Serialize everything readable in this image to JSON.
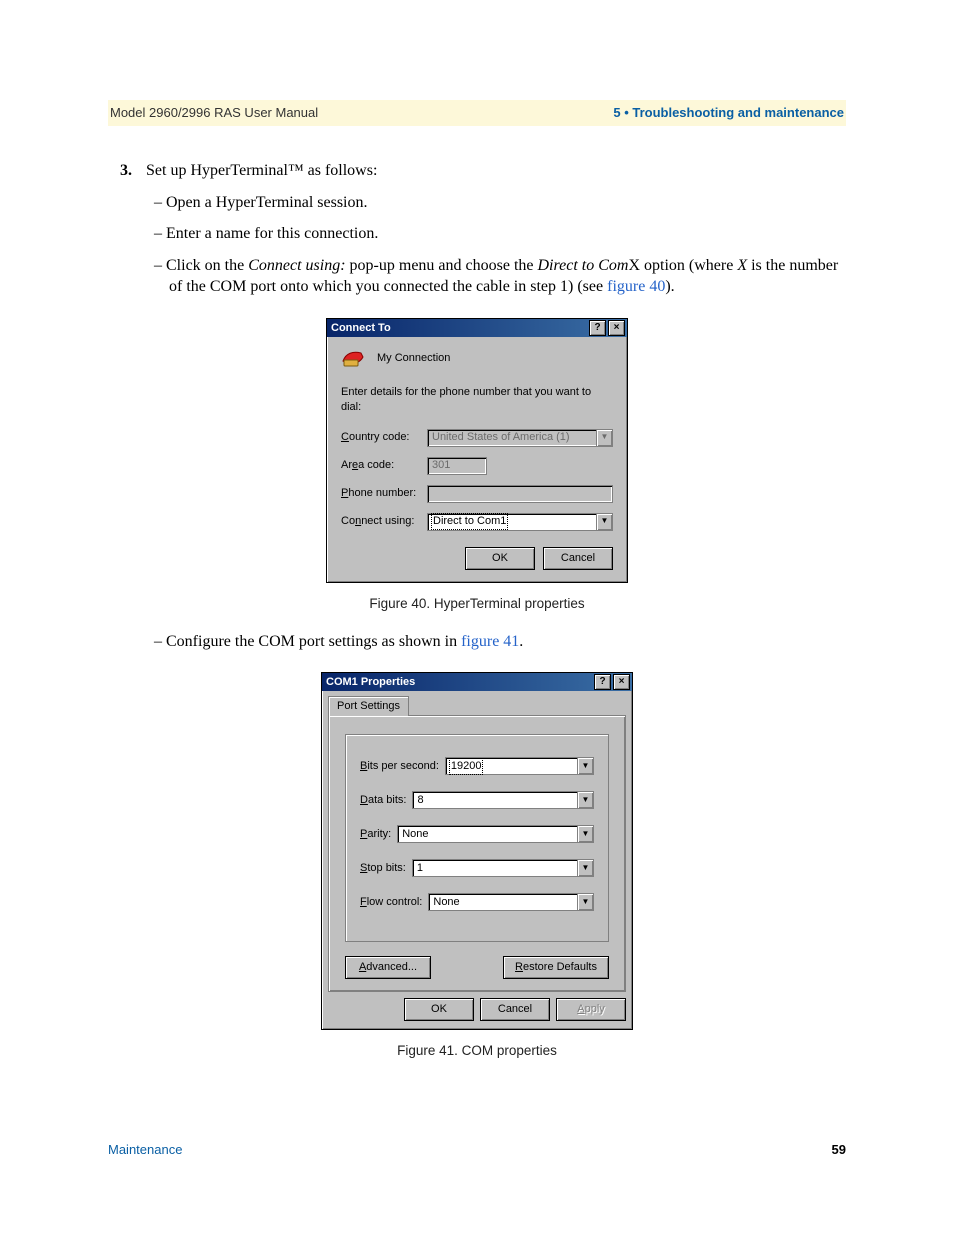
{
  "header": {
    "left": "Model 2960/2996 RAS User Manual",
    "right": "5 • Troubleshooting and maintenance"
  },
  "step": {
    "num": "3.",
    "text": "Set up HyperTerminal™ as follows:"
  },
  "bul": {
    "a": "Open a HyperTerminal session.",
    "b": "Enter a name for this connection.",
    "c_pre": "Click on the ",
    "c_i1": "Connect using:",
    "c_mid": " pop-up menu and choose the ",
    "c_i2": "Direct to Com",
    "c_x": "X option (where ",
    "c_i3": "X",
    "c_post": " is the number of the COM port onto which you connected the cable in step 1) (see ",
    "c_link": "figure 40",
    "c_end": ").",
    "d_pre": "Configure the COM port settings as shown in ",
    "d_link": "figure 41",
    "d_end": "."
  },
  "fig40": {
    "title": "Connect To",
    "help": "?",
    "close": "×",
    "conn": "My Connection",
    "prompt": "Enter details for the phone number that you want to dial:",
    "country_l": "ountry code:",
    "country_u": "C",
    "country_v": "United States of America (1)",
    "area_l": "Ar",
    "area_u": "e",
    "area_l2": "a code:",
    "area_v": "301",
    "phone_l": "hone number:",
    "phone_u": "P",
    "phone_v": "",
    "connect_l": "Co",
    "connect_u": "n",
    "connect_l2": "nect using:",
    "connect_v": "Direct to Com1",
    "ok": "OK",
    "cancel": "Cancel",
    "cap": "Figure 40. HyperTerminal properties"
  },
  "fig41": {
    "title": "COM1 Properties",
    "help": "?",
    "close": "×",
    "tab": "Port Settings",
    "bits_l": "its per second:",
    "bits_u": "B",
    "bits_v": "19200",
    "data_l": "ata bits:",
    "data_u": "D",
    "data_v": "8",
    "par_l": "arity:",
    "par_u": "P",
    "par_v": "None",
    "stop_l": "top bits:",
    "stop_u": "S",
    "stop_v": "1",
    "flow_l": "low control:",
    "flow_u": "F",
    "flow_v": "None",
    "adv_u": "A",
    "adv": "dvanced...",
    "rest_u": "R",
    "rest": "estore Defaults",
    "ok": "OK",
    "cancel": "Cancel",
    "apply": "Apply",
    "apply_u": "A",
    "cap": "Figure 41. COM properties"
  },
  "footer": {
    "left": "Maintenance",
    "right": "59"
  }
}
